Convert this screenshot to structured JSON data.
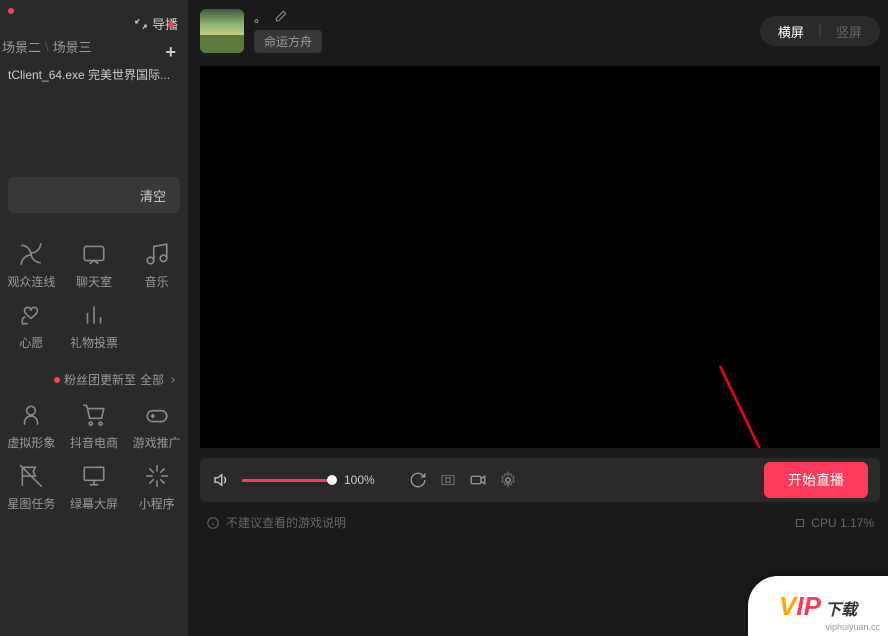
{
  "sidebar": {
    "swap_label": "导播",
    "scene_tabs": [
      "场景二",
      "场景三"
    ],
    "source": "tClient_64.exe 完美世界国际...",
    "clear_label": "清空",
    "grid1": [
      {
        "label": "观众连线",
        "name": "audience-link"
      },
      {
        "label": "聊天室",
        "name": "chat-room"
      },
      {
        "label": "音乐",
        "name": "music"
      },
      {
        "label": "心愿",
        "name": "wish"
      },
      {
        "label": "礼物投票",
        "name": "gift-vote"
      }
    ],
    "fans_text": "粉丝团更新至",
    "fans_all": "全部",
    "grid2": [
      {
        "label": "虚拟形象",
        "name": "avatar-virtual"
      },
      {
        "label": "抖音电商",
        "name": "ecommerce"
      },
      {
        "label": "游戏推广",
        "name": "game-promo"
      },
      {
        "label": "星图任务",
        "name": "star-task"
      },
      {
        "label": "绿幕大屏",
        "name": "green-screen"
      },
      {
        "label": "小程序",
        "name": "mini-program"
      }
    ]
  },
  "header": {
    "name_dot": "。",
    "tag": "命运方舟",
    "orient_h": "横屏",
    "orient_v": "竖屏"
  },
  "controls": {
    "volume_pct": 100,
    "volume_txt": "100%",
    "start_label": "开始直播"
  },
  "footer": {
    "left": "不建议查看的游戏说明",
    "cpu": "CPU 1.17%"
  },
  "watermark": {
    "vip": "VIP",
    "txt": "下载",
    "url": "viphuiyuan.cc"
  }
}
